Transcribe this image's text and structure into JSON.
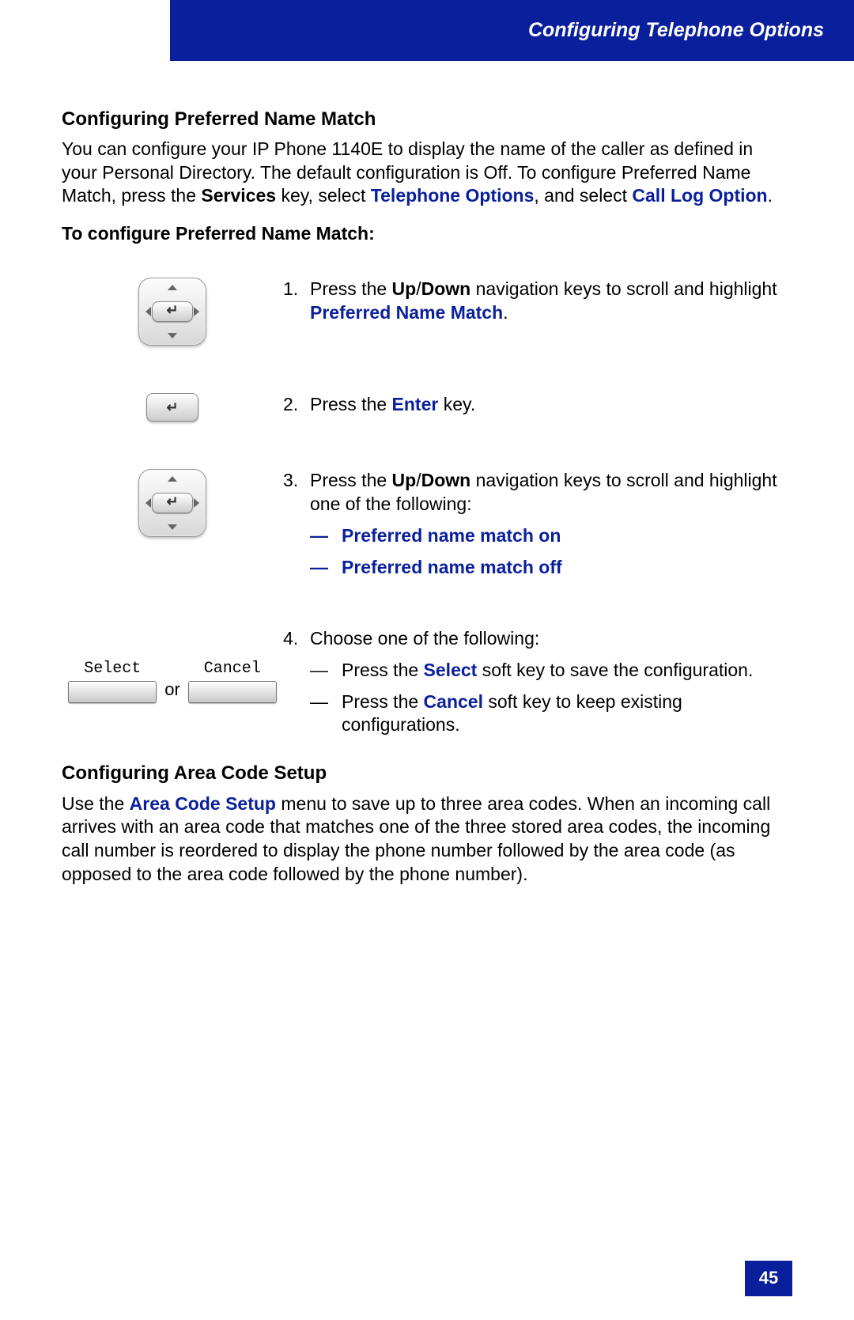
{
  "header": {
    "title": "Configuring Telephone Options"
  },
  "section1": {
    "heading": "Configuring Preferred Name Match",
    "intro_before_services": "You can configure your IP Phone 1140E to display the name of the caller as defined in your Personal Directory. The default configuration is Off. To configure Preferred Name Match, press the ",
    "services": "Services",
    "intro_mid1": " key, select ",
    "telephone_options": "Telephone Options",
    "intro_mid2": ", and select ",
    "call_log_option": "Call Log Option",
    "intro_end": ".",
    "subheading": "To configure Preferred Name Match:"
  },
  "steps": {
    "s1": {
      "num": "1.",
      "t1": "Press the ",
      "up": "Up",
      "slash": "/",
      "down": "Down",
      "t2": " navigation keys to scroll and highlight ",
      "pref": "Preferred Name Match",
      "t3": "."
    },
    "s2": {
      "num": "2.",
      "t1": "Press the ",
      "enter": "Enter",
      "t2": " key."
    },
    "s3": {
      "num": "3.",
      "t1": "Press the ",
      "up": "Up",
      "slash": "/",
      "down": "Down",
      "t2": " navigation keys to scroll and highlight one of the following:",
      "dash": "—",
      "opt_on": "Preferred name match on",
      "opt_off": "Preferred name match off"
    },
    "s4": {
      "num": "4.",
      "t1": "Choose one of the following:",
      "dash": "—",
      "opt_a1": "Press the ",
      "select": "Select",
      "opt_a2": " soft key to save the configuration.",
      "opt_b1": "Press the ",
      "cancel": "Cancel",
      "opt_b2": " soft key to keep existing configurations."
    }
  },
  "softkeys": {
    "select_label": "Select",
    "cancel_label": "Cancel",
    "or": "or"
  },
  "section2": {
    "heading": "Configuring Area Code Setup",
    "t1": "Use the ",
    "acs": "Area Code Setup",
    "t2": " menu to save up to three area codes. When an incoming call arrives with an area code that matches one of the three stored area codes, the incoming call number is reordered to display the phone number followed by the area code (as opposed to the area code followed by the phone number)."
  },
  "page_number": "45"
}
